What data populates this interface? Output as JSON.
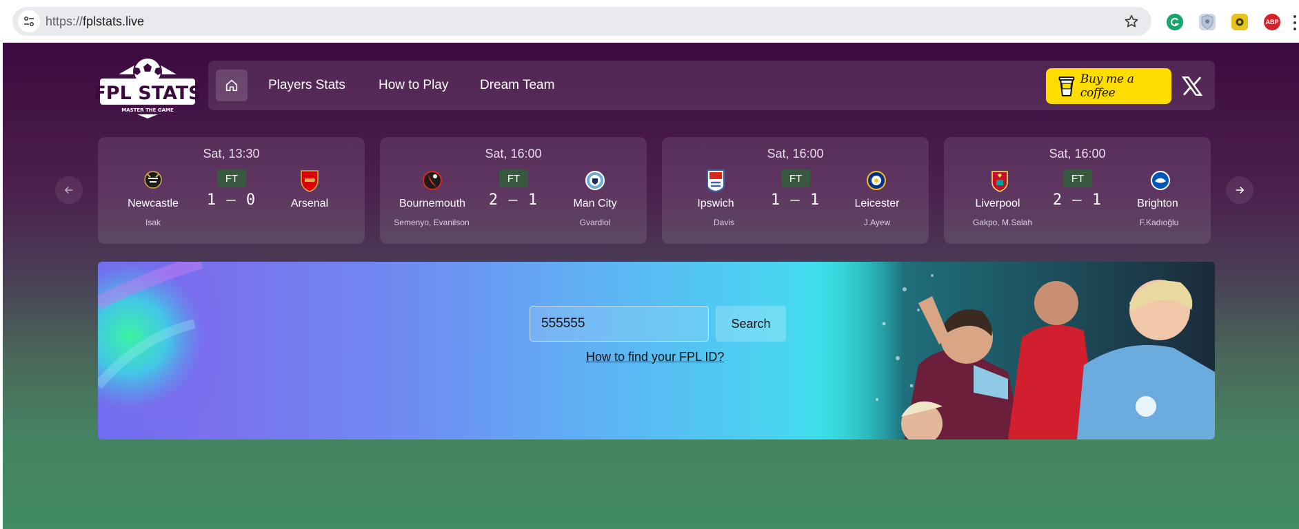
{
  "browser": {
    "url_scheme": "https://",
    "url_host": "fplstats.live",
    "extensions": [
      "grammarly-icon",
      "shield-extension-icon",
      "yellow-extension-icon",
      "adblock-plus-icon"
    ],
    "abp_label": "ABP"
  },
  "site": {
    "logo_text": "FPL STATS",
    "logo_tagline": "MASTER THE GAME"
  },
  "nav": {
    "links": [
      "Players Stats",
      "How to Play",
      "Dream Team"
    ],
    "coffee_label": "Buy me a coffee"
  },
  "fixtures": [
    {
      "time": "Sat, 13:30",
      "status": "FT",
      "score": "1 – 0",
      "home": {
        "name": "Newcastle",
        "scorers": "Isak",
        "color": "#1c1c1c"
      },
      "away": {
        "name": "Arsenal",
        "scorers": "",
        "color": "#db0007"
      }
    },
    {
      "time": "Sat, 16:00",
      "status": "FT",
      "score": "2 – 1",
      "home": {
        "name": "Bournemouth",
        "scorers": "Semenyo, Evanilson",
        "color": "#da291c"
      },
      "away": {
        "name": "Man City",
        "scorers": "Gvardiol",
        "color": "#6cabdd"
      }
    },
    {
      "time": "Sat, 16:00",
      "status": "FT",
      "score": "1 – 1",
      "home": {
        "name": "Ipswich",
        "scorers": "Davis",
        "color": "#3a64a3"
      },
      "away": {
        "name": "Leicester",
        "scorers": "J.Ayew",
        "color": "#003090"
      }
    },
    {
      "time": "Sat, 16:00",
      "status": "FT",
      "score": "2 – 1",
      "home": {
        "name": "Liverpool",
        "scorers": "Gakpo, M.Salah",
        "color": "#c8102e"
      },
      "away": {
        "name": "Brighton",
        "scorers": "F.Kadıoğlu",
        "color": "#0057b8"
      }
    }
  ],
  "hero": {
    "search_value": "555555",
    "search_button": "Search",
    "help_link": "How to find your FPL ID?"
  },
  "colors": {
    "page_top": "#3c0a3f",
    "page_bottom": "#428b63",
    "coffee_yellow": "#ffdd00",
    "ft_badge": "#38583f"
  }
}
